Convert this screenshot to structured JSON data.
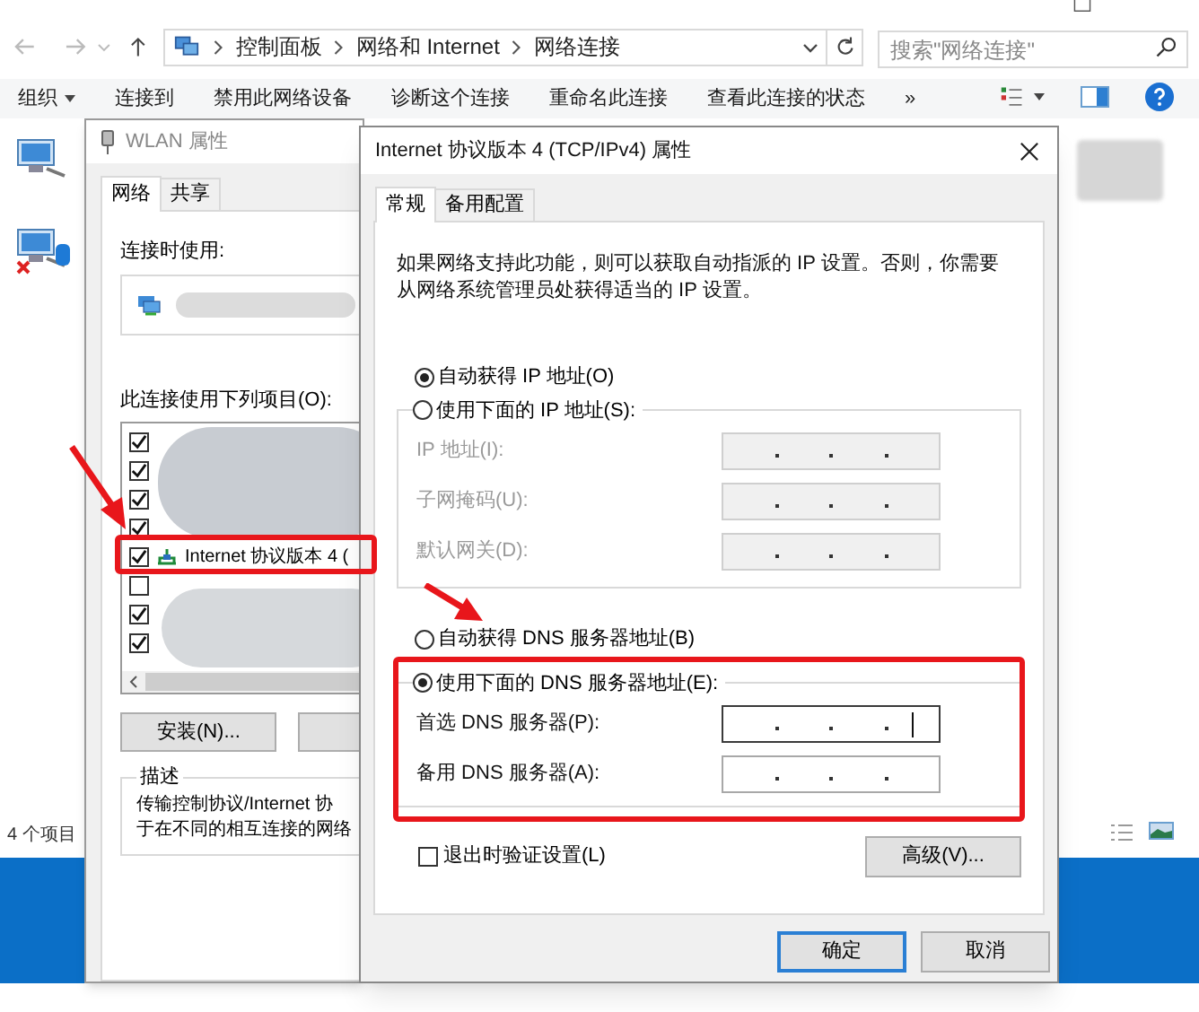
{
  "explorer": {
    "breadcrumb": [
      "控制面板",
      "网络和 Internet",
      "网络连接"
    ],
    "search": {
      "placeholder": "搜索\"网络连接\""
    },
    "toolbar": [
      {
        "label": "组织",
        "kind": "menu"
      },
      {
        "label": "连接到",
        "kind": "command"
      },
      {
        "label": "禁用此网络设备",
        "kind": "command"
      },
      {
        "label": "诊断这个连接",
        "kind": "command"
      },
      {
        "label": "重命名此连接",
        "kind": "command"
      },
      {
        "label": "查看此连接的状态",
        "kind": "command"
      },
      {
        "label": "»",
        "kind": "more"
      }
    ],
    "status_bar": "4 个项目"
  },
  "wlan_dialog": {
    "title": "WLAN 属性",
    "tabs": [
      {
        "label": "网络",
        "selected": true
      },
      {
        "label": "共享",
        "selected": false
      }
    ],
    "connect_using_label": "连接时使用:",
    "items_label": "此连接使用下列项目(O):",
    "items": [
      {
        "checked": true
      },
      {
        "checked": true
      },
      {
        "checked": true
      },
      {
        "checked": true
      },
      {
        "name": "Internet 协议版本 4 (",
        "checked": true
      },
      {
        "checked": false
      },
      {
        "checked": true
      },
      {
        "checked": true
      }
    ],
    "install_button": "安装(N)...",
    "description_label": "描述",
    "description_lines": [
      "传输控制协议/Internet 协",
      "于在不同的相互连接的网络"
    ]
  },
  "tcp_dialog": {
    "title": "Internet 协议版本 4 (TCP/IPv4) 属性",
    "tabs": [
      {
        "label": "常规",
        "selected": true
      },
      {
        "label": "备用配置",
        "selected": false
      }
    ],
    "intro": "如果网络支持此功能，则可以获取自动指派的 IP 设置。否则，你需要从网络系统管理员处获得适当的 IP 设置。",
    "ip_options": [
      {
        "label": "自动获得 IP 地址(O)",
        "selected": true
      },
      {
        "label": "使用下面的 IP 地址(S):",
        "selected": false
      }
    ],
    "ip_fields": [
      {
        "label": "IP 地址(I):",
        "disabled": true,
        "focused": false
      },
      {
        "label": "子网掩码(U):",
        "disabled": true,
        "focused": false
      },
      {
        "label": "默认网关(D):",
        "disabled": true,
        "focused": false
      }
    ],
    "dns_options": [
      {
        "label": "自动获得 DNS 服务器地址(B)",
        "selected": false
      },
      {
        "label": "使用下面的 DNS 服务器地址(E):",
        "selected": true
      }
    ],
    "dns_fields": [
      {
        "label": "首选 DNS 服务器(P):",
        "disabled": false,
        "focused": true
      },
      {
        "label": "备用 DNS 服务器(A):",
        "disabled": false,
        "focused": false
      }
    ],
    "validate_on_exit": {
      "label": "退出时验证设置(L)",
      "checked": false
    },
    "advanced_button": "高级(V)...",
    "ok_button": "确定",
    "cancel_button": "取消"
  }
}
